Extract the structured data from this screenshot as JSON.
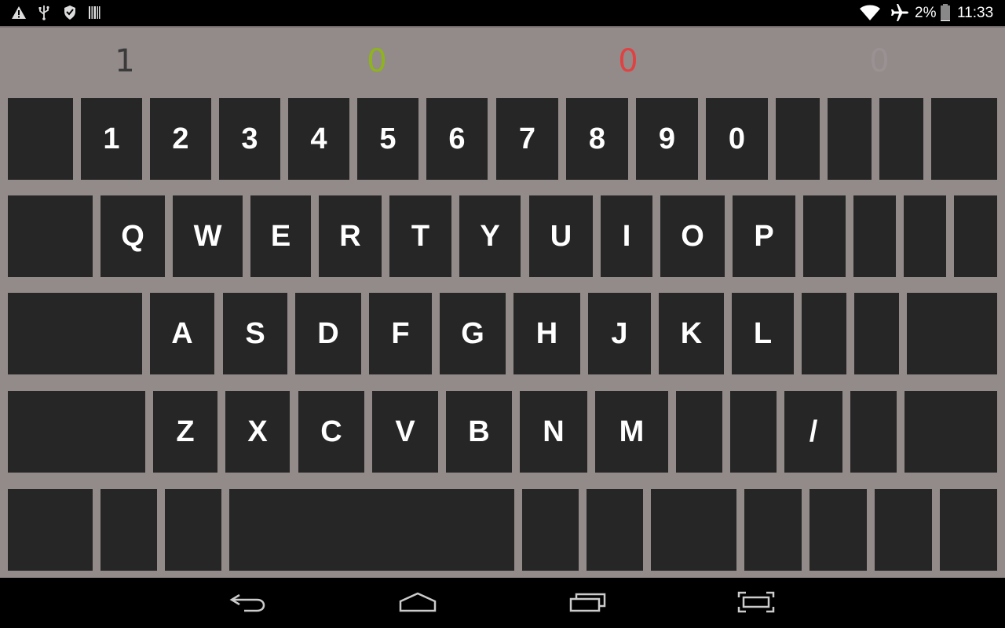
{
  "status_bar": {
    "left_icons": [
      "warning-icon",
      "usb-icon",
      "shield-icon",
      "barcode-icon"
    ],
    "right_icons": [
      "wifi-icon",
      "airplane-icon",
      "battery-icon"
    ],
    "battery_percent": "2%",
    "battery_level": 0.02,
    "time": "11:33"
  },
  "counters": [
    {
      "value": "1",
      "color": "#3a3a3a"
    },
    {
      "value": "0",
      "color": "#8fb31c"
    },
    {
      "value": "0",
      "color": "#e04242"
    },
    {
      "value": "0",
      "color": "#9a9292"
    }
  ],
  "keyboard": {
    "rows": [
      [
        "",
        "1",
        "2",
        "3",
        "4",
        "5",
        "6",
        "7",
        "8",
        "9",
        "0",
        "",
        "",
        "",
        ""
      ],
      [
        "",
        "Q",
        "W",
        "E",
        "R",
        "T",
        "Y",
        "U",
        "I",
        "O",
        "P",
        "",
        "",
        "",
        ""
      ],
      [
        "",
        "A",
        "S",
        "D",
        "F",
        "G",
        "H",
        "J",
        "K",
        "L",
        "",
        "",
        ""
      ],
      [
        "",
        "Z",
        "X",
        "C",
        "V",
        "B",
        "N",
        "M",
        "",
        "",
        "/",
        "",
        ""
      ],
      [
        "",
        "",
        "",
        "",
        "",
        "",
        "",
        "",
        "",
        "",
        "",
        ""
      ]
    ],
    "key_color": "#262626",
    "background_color": "#938b8a"
  },
  "nav_bar": {
    "buttons": [
      "back-icon",
      "home-icon",
      "recent-apps-icon",
      "screenshot-icon"
    ]
  }
}
